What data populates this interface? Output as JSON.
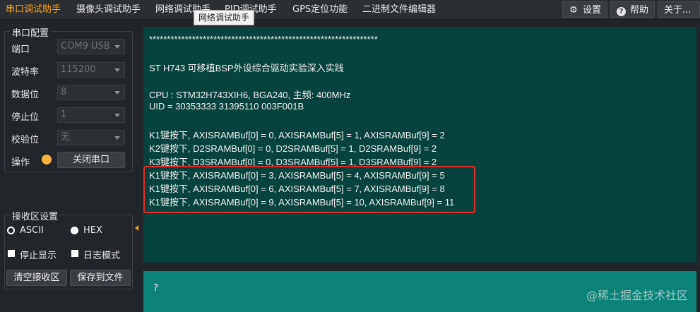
{
  "menu": {
    "items": [
      "串口调试助手",
      "摄像头调试助手",
      "网络调试助手",
      "PID调试助手",
      "GPS定位功能",
      "二进制文件编辑器"
    ],
    "tooltip": "网络调试助手",
    "settings_label": "设置",
    "help_label": "帮助",
    "about_label": "关于..."
  },
  "serial_config": {
    "title": "串口配置",
    "port_label": "端口",
    "port_value": "COM9 USB",
    "baud_label": "波特率",
    "baud_value": "115200",
    "databits_label": "数据位",
    "databits_value": "8",
    "stopbits_label": "停止位",
    "stopbits_value": "1",
    "parity_label": "校验位",
    "parity_value": "无",
    "op_label": "操作",
    "close_port_label": "关闭串口"
  },
  "recv_settings": {
    "title": "接收区设置",
    "ascii_label": "ASCII",
    "hex_label": "HEX",
    "stop_display_label": "停止显示",
    "log_mode_label": "日志模式",
    "clear_label": "清空接收区",
    "save_label": "保存到文件"
  },
  "receive": {
    "lines": [
      "****************************************************************",
      "",
      "ST H743 可移植BSP外设综合驱动实验深入实践",
      "",
      "CPU : STM32H743XIH6, BGA240, 主频: 400MHz",
      "UID = 30353333 31395110 003F001B",
      "",
      "K1键按下, AXISRAMBuf[0] = 0, AXISRAMBuf[5] = 1, AXISRAMBuf[9] = 2",
      "K2键按下, D2SRAMBuf[0] = 0, D2SRAMBuf[5] = 1, D2SRAMBuf[9] = 2",
      "K3键按下, D3SRAMBuf[0] = 0, D3SRAMBuf[5] = 1, D3SRAMBuf[9] = 2",
      "K1键按下, AXISRAMBuf[0] = 3, AXISRAMBuf[5] = 4, AXISRAMBuf[9] = 5",
      "K1键按下, AXISRAMBuf[0] = 6, AXISRAMBuf[5] = 7, AXISRAMBuf[9] = 8",
      "K1键按下, AXISRAMBuf[0] = 9, AXISRAMBuf[5] = 10, AXISRAMBuf[9] = 11"
    ]
  },
  "send": {
    "text": "?"
  },
  "watermark": "@稀土掘金技术社区",
  "colors": {
    "accent": "#f5a623",
    "receive_bg": "#07433c",
    "send_bg": "#0b8178",
    "highlight": "#e02a2a"
  }
}
